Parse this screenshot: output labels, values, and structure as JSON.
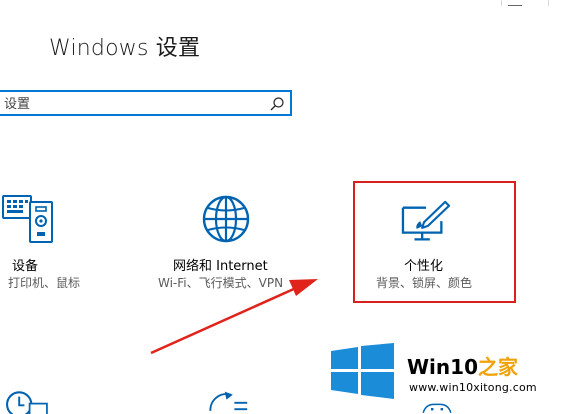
{
  "window": {
    "title": "Windows 设置"
  },
  "search": {
    "placeholder": "设置"
  },
  "tiles": [
    {
      "id": "devices",
      "title": "设备",
      "subtitle": "打印机、鼠标",
      "icon": "devices-keyboard-icon"
    },
    {
      "id": "network",
      "title": "网络和 Internet",
      "subtitle": "Wi-Fi、飞行模式、VPN",
      "icon": "globe-icon"
    },
    {
      "id": "personalization",
      "title": "个性化",
      "subtitle": "背景、锁屏、颜色",
      "icon": "personalization-pen-icon",
      "highlighted": true
    }
  ],
  "lower_icons": [
    "time-language-icon",
    "update-security-icon",
    "gaming-icon"
  ],
  "annotation": {
    "arrow": "red-pointer-arrow",
    "highlight_color": "#d9201c"
  },
  "watermark": {
    "brand_prefix": "Win10",
    "brand_suffix": "之家",
    "url": "www.win10xitong.com"
  },
  "colors": {
    "accent": "#0078d7",
    "highlight": "#d9201c",
    "watermark_accent": "#f0a20a"
  }
}
